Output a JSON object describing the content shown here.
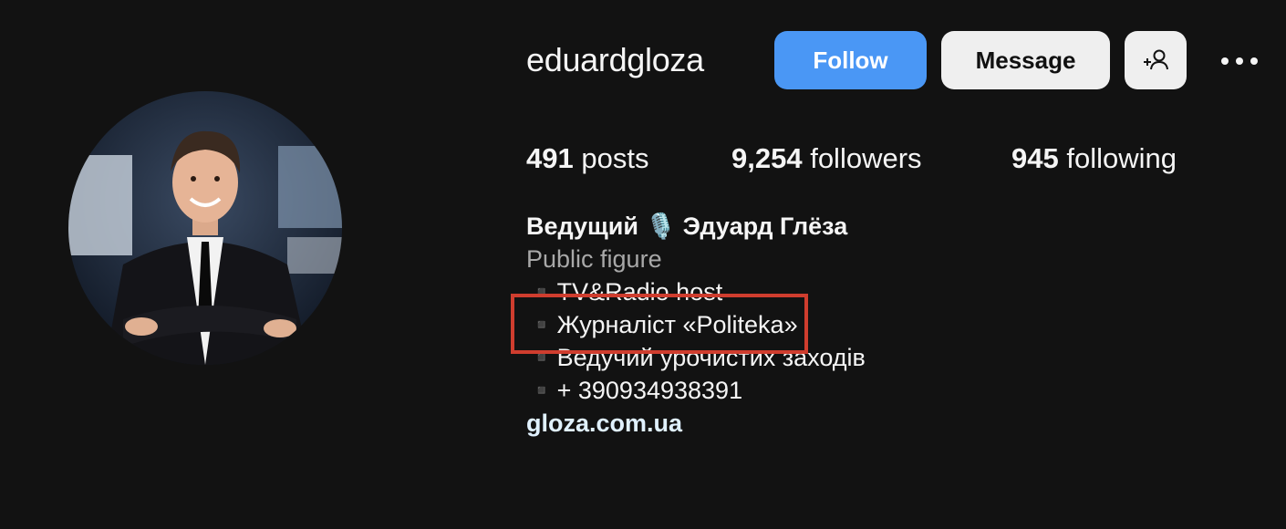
{
  "profile": {
    "username": "eduardgloza",
    "avatar_icon": "profile-photo",
    "follow_label": "Follow",
    "message_label": "Message",
    "add_user_icon": "add-user-icon",
    "more_icon": "more-options-icon"
  },
  "stats": {
    "posts_count": "491",
    "posts_label": "posts",
    "followers_count": "9,254",
    "followers_label": "followers",
    "following_count": "945",
    "following_label": "following"
  },
  "bio": {
    "full_name": "Ведущий 🎙️ Эдуард Глёза",
    "category": "Public figure",
    "lines": [
      "▪️TV&Radio host",
      "▪️Журналіст «Politeka»",
      "▪️Ведучий урочистих заходів",
      "▪️+ 390934938391"
    ],
    "link": "gloza.com.ua"
  },
  "colors": {
    "background": "#121212",
    "follow_button": "#4a97f5",
    "secondary_button": "#efefef",
    "highlight": "#cf3d2e",
    "link": "#e0f1ff"
  }
}
